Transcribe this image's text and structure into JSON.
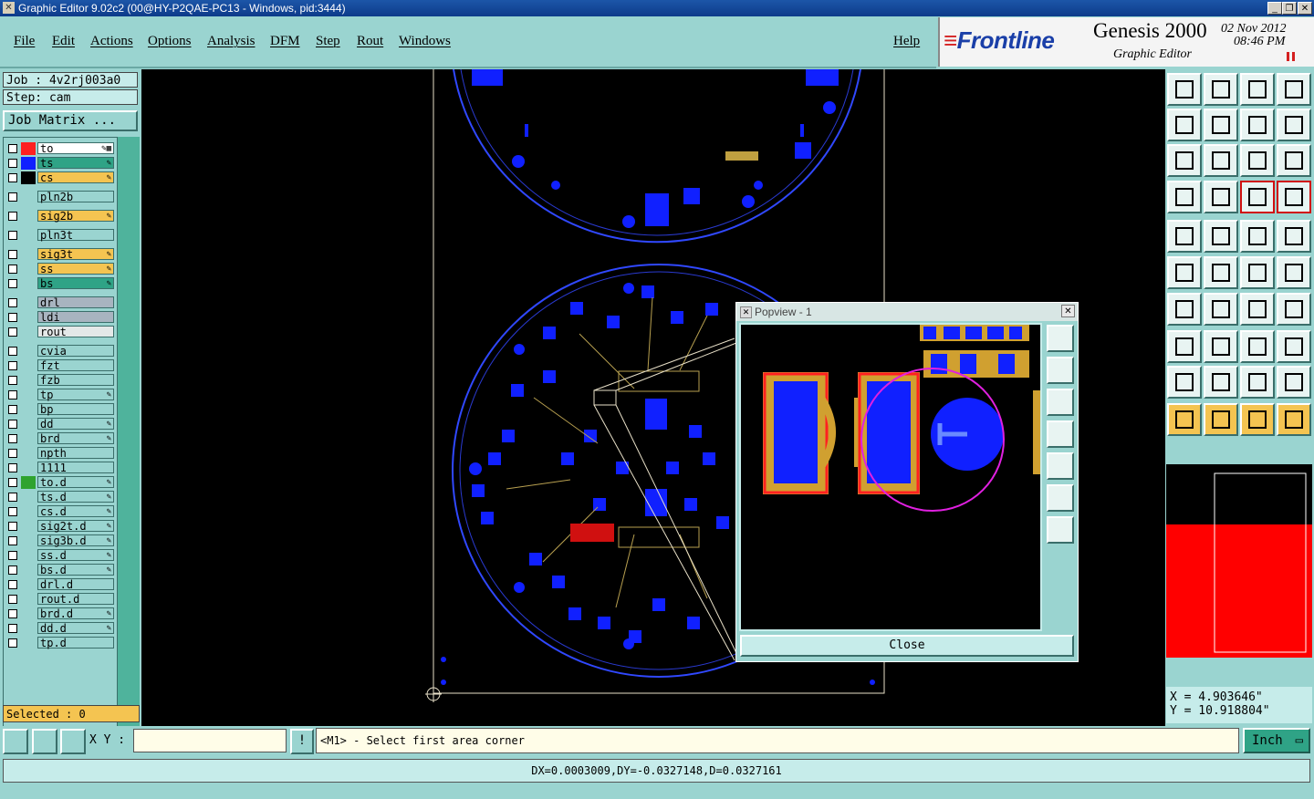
{
  "window": {
    "title": "Graphic Editor 9.02c2 (00@HY-P2QAE-PC13 - Windows, pid:3444)",
    "controls": [
      "_",
      "❐",
      "✕"
    ]
  },
  "menu": [
    "File",
    "Edit",
    "Actions",
    "Options",
    "Analysis",
    "DFM",
    "Step",
    "Rout",
    "Windows"
  ],
  "help_label": "Help",
  "brand": {
    "logo": "Frontline",
    "product": "Genesis 2000",
    "module": "Graphic Editor",
    "date": "02 Nov 2012",
    "time": "08:46 PM",
    "accent": "#1a3fa8"
  },
  "job": {
    "job_label": "Job : 4v2rj003a0",
    "step_label": "Step: cam",
    "matrix_button": "Job Matrix ..."
  },
  "layers": [
    {
      "name": "to",
      "color": "#ff2020",
      "bg": "#ffffff",
      "mark": "✎▦"
    },
    {
      "name": "ts",
      "color": "#1020ff",
      "bg": "#2fa386",
      "mark": "✎"
    },
    {
      "name": "cs",
      "color": "#000000",
      "bg": "#f4c451",
      "mark": "✎"
    },
    {
      "name": "pln2b",
      "color": "",
      "bg": "#9ad4d0",
      "mark": ""
    },
    {
      "name": "sig2b",
      "color": "",
      "bg": "#f4c451",
      "mark": "✎"
    },
    {
      "name": "pln3t",
      "color": "",
      "bg": "#9ad4d0",
      "mark": ""
    },
    {
      "name": "sig3t",
      "color": "",
      "bg": "#f4c451",
      "mark": "✎"
    },
    {
      "name": "ss",
      "color": "",
      "bg": "#f4c451",
      "mark": "✎"
    },
    {
      "name": "bs",
      "color": "",
      "bg": "#2fa386",
      "mark": "✎"
    },
    {
      "name": "drl",
      "color": "",
      "bg": "#a8b4c0",
      "mark": ""
    },
    {
      "name": "ldi",
      "color": "",
      "bg": "#a8b4c0",
      "mark": ""
    },
    {
      "name": "rout",
      "color": "",
      "bg": "#e4e8e8",
      "mark": ""
    },
    {
      "name": "cvia",
      "color": "",
      "bg": "#9ad4d0",
      "mark": ""
    },
    {
      "name": "fzt",
      "color": "",
      "bg": "#9ad4d0",
      "mark": ""
    },
    {
      "name": "fzb",
      "color": "",
      "bg": "#9ad4d0",
      "mark": ""
    },
    {
      "name": "tp",
      "color": "",
      "bg": "#9ad4d0",
      "mark": "✎"
    },
    {
      "name": "bp",
      "color": "",
      "bg": "#9ad4d0",
      "mark": ""
    },
    {
      "name": "dd",
      "color": "",
      "bg": "#9ad4d0",
      "mark": "✎"
    },
    {
      "name": "brd",
      "color": "",
      "bg": "#9ad4d0",
      "mark": "✎"
    },
    {
      "name": "npth",
      "color": "",
      "bg": "#9ad4d0",
      "mark": ""
    },
    {
      "name": "1111",
      "color": "",
      "bg": "#9ad4d0",
      "mark": ""
    },
    {
      "name": "to.d",
      "color": "#2fa32f",
      "bg": "#9ad4d0",
      "mark": "✎"
    },
    {
      "name": "ts.d",
      "color": "",
      "bg": "#9ad4d0",
      "mark": "✎"
    },
    {
      "name": "cs.d",
      "color": "",
      "bg": "#9ad4d0",
      "mark": "✎"
    },
    {
      "name": "sig2t.d",
      "color": "",
      "bg": "#9ad4d0",
      "mark": "✎"
    },
    {
      "name": "sig3b.d",
      "color": "",
      "bg": "#9ad4d0",
      "mark": "✎"
    },
    {
      "name": "ss.d",
      "color": "",
      "bg": "#9ad4d0",
      "mark": "✎"
    },
    {
      "name": "bs.d",
      "color": "",
      "bg": "#9ad4d0",
      "mark": "✎"
    },
    {
      "name": "drl.d",
      "color": "",
      "bg": "#9ad4d0",
      "mark": ""
    },
    {
      "name": "rout.d",
      "color": "",
      "bg": "#9ad4d0",
      "mark": ""
    },
    {
      "name": "brd.d",
      "color": "",
      "bg": "#9ad4d0",
      "mark": "✎"
    },
    {
      "name": "dd.d",
      "color": "",
      "bg": "#9ad4d0",
      "mark": "✎"
    },
    {
      "name": "tp.d",
      "color": "",
      "bg": "#9ad4d0",
      "mark": ""
    }
  ],
  "selected_label": "Selected : 0",
  "popview": {
    "title": "Popview - 1",
    "close_label": "Close"
  },
  "coords": {
    "x": "X = 4.903646\"",
    "y": "Y = 10.918804\""
  },
  "xy_label": "X Y :",
  "xy_value": "",
  "prompt": "<M1> - Select first area corner",
  "prompt_icon": "!",
  "units": "Inch",
  "status": "DX=0.0003009,DY=-0.0327148,D=0.0327161",
  "overview_highlight": "#ff0000",
  "pcb_blue": "#1020ff"
}
